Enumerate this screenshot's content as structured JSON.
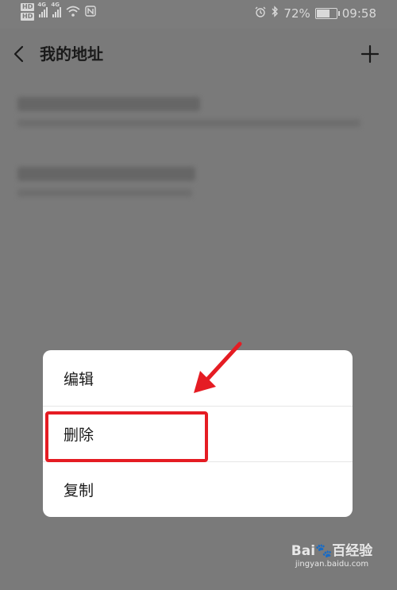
{
  "status_bar": {
    "signal_labels": [
      "HD",
      "HD",
      "4G",
      "4G"
    ],
    "battery_percent": "72%",
    "battery_level": 0.72,
    "time": "09:58",
    "icons": [
      "wifi-icon",
      "nfc-icon",
      "alarm-icon",
      "bluetooth-icon",
      "battery-icon"
    ]
  },
  "header": {
    "title": "我的地址",
    "back_icon": "chevron-left-icon",
    "add_icon": "plus-icon"
  },
  "addresses": [
    {
      "name": "",
      "detail": ""
    },
    {
      "name": "",
      "detail": ""
    }
  ],
  "context_menu": {
    "items": [
      {
        "label": "编辑"
      },
      {
        "label": "删除"
      },
      {
        "label": "复制"
      }
    ]
  },
  "annotation": {
    "color": "#e51c23"
  },
  "watermark": {
    "logo": "Bai🐾百经验",
    "url": "jingyan.baidu.com"
  }
}
